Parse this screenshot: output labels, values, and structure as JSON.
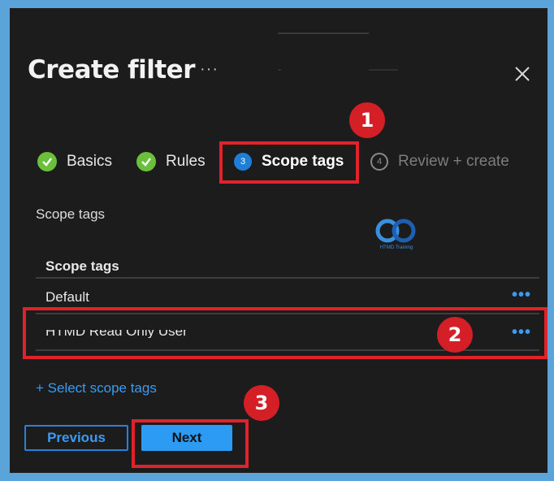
{
  "panel": {
    "title": "Create filter",
    "more_label": "···",
    "close_label": "Close"
  },
  "steps": [
    {
      "number": "",
      "label": "Basics",
      "state": "complete"
    },
    {
      "number": "",
      "label": "Rules",
      "state": "complete"
    },
    {
      "number": "3",
      "label": "Scope tags",
      "state": "active"
    },
    {
      "number": "4",
      "label": "Review + create",
      "state": "inactive"
    }
  ],
  "scope_tags": {
    "section_label": "Scope tags",
    "column_header": "Scope tags",
    "rows": [
      {
        "name": "Default",
        "more": "•••"
      },
      {
        "name": "HTMD Read Only User",
        "more": "•••"
      }
    ],
    "select_link": "+ Select scope tags"
  },
  "watermark": {
    "text": "HTMD Training",
    "icon": "htmd-logo-icon"
  },
  "footer": {
    "previous_label": "Previous",
    "next_label": "Next"
  },
  "annotations": {
    "badge_1": "1",
    "badge_2": "2",
    "badge_3": "3",
    "highlight_color": "#e0232b"
  },
  "colors": {
    "accent": "#2b9bf4",
    "link": "#3b9bf2",
    "complete": "#6abf3b",
    "panel_bg": "#1c1c1c",
    "frame_bg": "#5aa4d9"
  }
}
